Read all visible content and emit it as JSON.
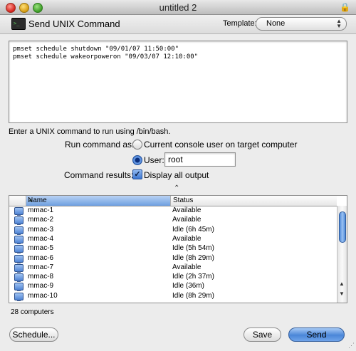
{
  "window": {
    "title": "untitled 2"
  },
  "commandbar": {
    "title": "Send UNIX Command",
    "template_label": "Template:",
    "template_value": "None"
  },
  "command": {
    "lines": [
      "pmset schedule shutdown \"09/01/07 11:50:00\"",
      "pmset schedule wakeorpoweron \"09/03/07 12:10:00\""
    ]
  },
  "hint": "Enter a UNIX command to run using /bin/bash.",
  "run_as": {
    "label": "Run command as:",
    "option_console": "Current console user on target computer",
    "option_user": "User:",
    "user_value": "root",
    "selected": "user"
  },
  "results": {
    "label": "Command results:",
    "display_all": "Display all output",
    "display_all_checked": true
  },
  "table": {
    "columns": [
      "Name",
      "Status"
    ],
    "sorted_by": "Name",
    "rows": [
      {
        "name": "mmac-1",
        "status": "Available"
      },
      {
        "name": "mmac-2",
        "status": "Available"
      },
      {
        "name": "mmac-3",
        "status": "Idle (6h 45m)"
      },
      {
        "name": "mmac-4",
        "status": "Available"
      },
      {
        "name": "mmac-5",
        "status": "Idle (5h 54m)"
      },
      {
        "name": "mmac-6",
        "status": "Idle (8h 29m)"
      },
      {
        "name": "mmac-7",
        "status": "Available"
      },
      {
        "name": "mmac-8",
        "status": "Idle (2h 37m)"
      },
      {
        "name": "mmac-9",
        "status": "Idle (36m)"
      },
      {
        "name": "mmac-10",
        "status": "Idle (8h 29m)"
      }
    ]
  },
  "footer": {
    "count": "28 computers",
    "schedule_label": "Schedule...",
    "save_label": "Save",
    "send_label": "Send"
  }
}
